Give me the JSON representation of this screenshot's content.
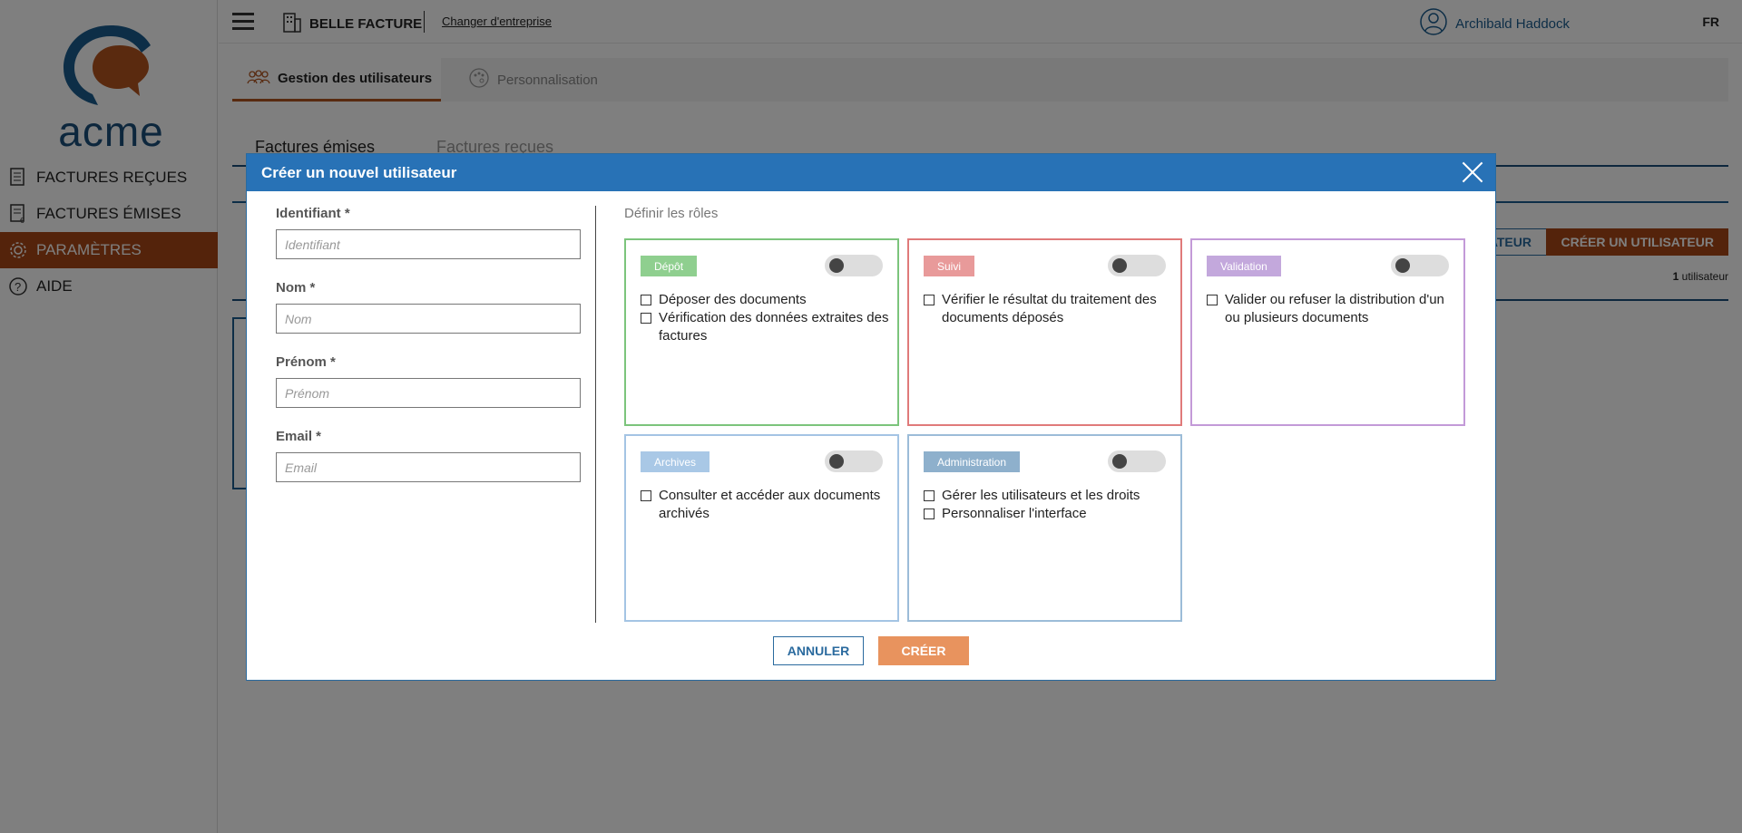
{
  "sidebar": {
    "logo_text": "acme",
    "items": [
      {
        "label": "FACTURES REÇUES",
        "icon": "received-invoices-icon"
      },
      {
        "label": "FACTURES ÉMISES",
        "icon": "issued-invoices-icon"
      },
      {
        "label": "PARAMÈTRES",
        "icon": "gear-icon"
      },
      {
        "label": "AIDE",
        "icon": "help-icon"
      }
    ],
    "active_color": "#a84716"
  },
  "header": {
    "company": "BELLE FACTURE",
    "change_company": "Changer d'entreprise",
    "user_name": "Archibald Haddock",
    "lang": "FR"
  },
  "main": {
    "tabs": [
      {
        "label": "Gestion des utilisateurs",
        "icon": "users-icon"
      },
      {
        "label": "Personnalisation",
        "icon": "palette-icon"
      }
    ],
    "subtabs": [
      {
        "label": "Factures émises"
      },
      {
        "label": "Factures reçues"
      }
    ],
    "button_partial": "ATEUR",
    "create_user_button": "CRÉER UN UTILISATEUR",
    "user_count_number": "1",
    "user_count_label": "utilisateur"
  },
  "modal": {
    "title": "Créer un nouvel utilisateur",
    "fields": [
      {
        "label": "Identifiant *",
        "placeholder": "Identifiant"
      },
      {
        "label": "Nom *",
        "placeholder": "Nom"
      },
      {
        "label": "Prénom *",
        "placeholder": "Prénom"
      },
      {
        "label": "Email *",
        "placeholder": "Email"
      }
    ],
    "roles_title": "Définir les rôles",
    "roles": [
      {
        "name": "Dépôt",
        "color": "#8fcf8f",
        "border": "#7cc47c",
        "permissions": [
          "Déposer des documents",
          "Vérification des données extraites des factures"
        ]
      },
      {
        "name": "Suivi",
        "color": "#e89a9a",
        "border": "#e07a7a",
        "permissions": [
          "Vérifier le résultat du traitement des documents déposés"
        ]
      },
      {
        "name": "Validation",
        "color": "#c3a8dc",
        "border": "#c39ad8",
        "permissions": [
          "Valider ou refuser la distribution d'un ou plusieurs documents"
        ]
      },
      {
        "name": "Archives",
        "color": "#a9c8e6",
        "border": "#a4c4e4",
        "permissions": [
          "Consulter et accéder aux documents archivés"
        ]
      },
      {
        "name": "Administration",
        "color": "#8eb0cc",
        "border": "#9cbcd8",
        "permissions": [
          "Gérer les utilisateurs et les droits",
          "Personnaliser l'interface"
        ]
      }
    ],
    "cancel_label": "ANNULER",
    "create_label": "CRÉER"
  }
}
